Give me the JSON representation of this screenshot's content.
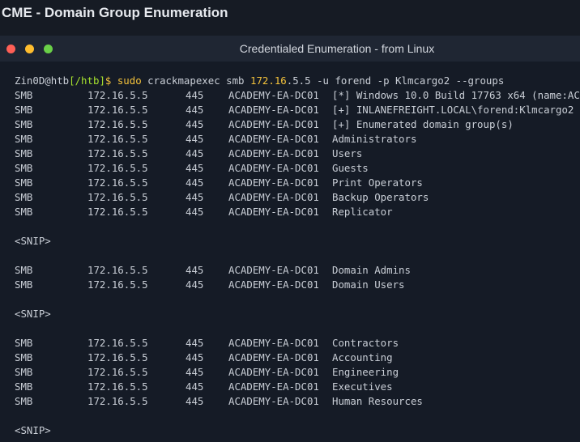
{
  "page_title": "CME - Domain Group Enumeration",
  "terminal": {
    "title": "Credentialed Enumeration - from Linux",
    "prompt": {
      "user_host": "Zin0D@htb",
      "path": "[/htb]",
      "symbol": "$",
      "sudo": "sudo",
      "command_a": "crackmapexec smb",
      "ip_prefix": "172.16",
      "ip_suffix": ".5.5",
      "command_b": "-u forend -p Klmcargo2 --groups"
    },
    "block1": [
      {
        "proto": "SMB",
        "ip": "172.16.5.5",
        "port": "445",
        "host": "ACADEMY-EA-DC01",
        "msg": "[*] Windows 10.0 Build 17763 x64 (name:AC"
      },
      {
        "proto": "SMB",
        "ip": "172.16.5.5",
        "port": "445",
        "host": "ACADEMY-EA-DC01",
        "msg": "[+] INLANEFREIGHT.LOCAL\\forend:Klmcargo2"
      },
      {
        "proto": "SMB",
        "ip": "172.16.5.5",
        "port": "445",
        "host": "ACADEMY-EA-DC01",
        "msg": "[+] Enumerated domain group(s)"
      },
      {
        "proto": "SMB",
        "ip": "172.16.5.5",
        "port": "445",
        "host": "ACADEMY-EA-DC01",
        "msg": "Administrators"
      },
      {
        "proto": "SMB",
        "ip": "172.16.5.5",
        "port": "445",
        "host": "ACADEMY-EA-DC01",
        "msg": "Users"
      },
      {
        "proto": "SMB",
        "ip": "172.16.5.5",
        "port": "445",
        "host": "ACADEMY-EA-DC01",
        "msg": "Guests"
      },
      {
        "proto": "SMB",
        "ip": "172.16.5.5",
        "port": "445",
        "host": "ACADEMY-EA-DC01",
        "msg": "Print Operators"
      },
      {
        "proto": "SMB",
        "ip": "172.16.5.5",
        "port": "445",
        "host": "ACADEMY-EA-DC01",
        "msg": "Backup Operators"
      },
      {
        "proto": "SMB",
        "ip": "172.16.5.5",
        "port": "445",
        "host": "ACADEMY-EA-DC01",
        "msg": "Replicator"
      }
    ],
    "snip": "<SNIP>",
    "block2": [
      {
        "proto": "SMB",
        "ip": "172.16.5.5",
        "port": "445",
        "host": "ACADEMY-EA-DC01",
        "msg": "Domain Admins"
      },
      {
        "proto": "SMB",
        "ip": "172.16.5.5",
        "port": "445",
        "host": "ACADEMY-EA-DC01",
        "msg": "Domain Users"
      }
    ],
    "block3": [
      {
        "proto": "SMB",
        "ip": "172.16.5.5",
        "port": "445",
        "host": "ACADEMY-EA-DC01",
        "msg": "Contractors"
      },
      {
        "proto": "SMB",
        "ip": "172.16.5.5",
        "port": "445",
        "host": "ACADEMY-EA-DC01",
        "msg": "Accounting"
      },
      {
        "proto": "SMB",
        "ip": "172.16.5.5",
        "port": "445",
        "host": "ACADEMY-EA-DC01",
        "msg": "Engineering"
      },
      {
        "proto": "SMB",
        "ip": "172.16.5.5",
        "port": "445",
        "host": "ACADEMY-EA-DC01",
        "msg": "Executives"
      },
      {
        "proto": "SMB",
        "ip": "172.16.5.5",
        "port": "445",
        "host": "ACADEMY-EA-DC01",
        "msg": "Human Resources"
      }
    ]
  }
}
